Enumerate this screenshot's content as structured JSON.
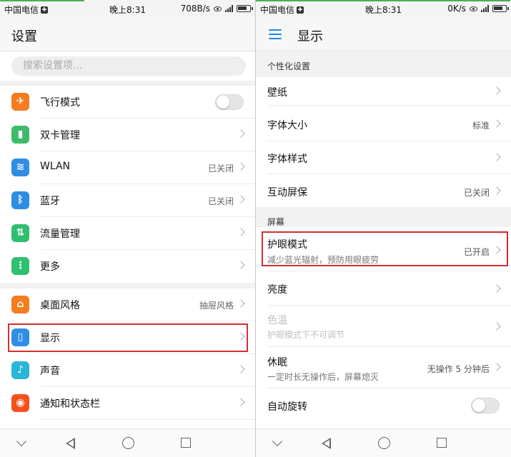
{
  "colors": {
    "accent": "#1e88e5",
    "highlight": "#d32f2f"
  },
  "left": {
    "status": {
      "carrier": "中国电信",
      "time": "晚上8:31",
      "speed": "708B/s",
      "signal": "4G"
    },
    "title": "设置",
    "search_placeholder": "搜索设置项...",
    "items": [
      {
        "label": "飞行模式",
        "icon": "airplane-icon",
        "glyph": "✈",
        "color": "#f57c1f"
      },
      {
        "label": "双卡管理",
        "icon": "sim-card-icon",
        "glyph": "▮",
        "color": "#3dbb6b"
      },
      {
        "label": "WLAN",
        "value": "已关闭",
        "icon": "wifi-icon",
        "glyph": "≋",
        "color": "#2f8de4"
      },
      {
        "label": "蓝牙",
        "value": "已关闭",
        "icon": "bluetooth-icon",
        "glyph": "ᛒ",
        "color": "#2f8de4"
      },
      {
        "label": "流量管理",
        "icon": "data-usage-icon",
        "glyph": "⇅",
        "color": "#2fbf71"
      },
      {
        "label": "更多",
        "icon": "more-icon",
        "glyph": "⋮",
        "color": "#2fbf71"
      },
      {
        "label": "桌面风格",
        "value": "抽屉风格",
        "icon": "home-style-icon",
        "glyph": "⌂",
        "color": "#f57c1f"
      },
      {
        "label": "显示",
        "icon": "display-icon",
        "glyph": "▯",
        "color": "#2f8de4"
      },
      {
        "label": "声音",
        "icon": "sound-icon",
        "glyph": "♪",
        "color": "#29b6d8"
      },
      {
        "label": "通知和状态栏",
        "icon": "notification-icon",
        "glyph": "◉",
        "color": "#f4511e"
      }
    ]
  },
  "right": {
    "status": {
      "carrier": "中国电信",
      "time": "晚上8:31",
      "speed": "0K/s",
      "signal": "4G"
    },
    "title": "显示",
    "sections": {
      "personalize": "个性化设置",
      "screen": "屏幕"
    },
    "items": {
      "wallpaper": {
        "label": "壁纸"
      },
      "font_size": {
        "label": "字体大小",
        "value": "标准"
      },
      "font_style": {
        "label": "字体样式"
      },
      "screensaver": {
        "label": "互动屏保",
        "value": "已关闭"
      },
      "eye_comfort": {
        "label": "护眼模式",
        "sub": "减少蓝光辐射，预防用眼疲劳",
        "value": "已开启"
      },
      "brightness": {
        "label": "亮度"
      },
      "color_temp": {
        "label": "色温",
        "sub": "护眼模式下不可调节"
      },
      "sleep": {
        "label": "休眠",
        "sub": "一定时长无操作后，屏幕熄灭",
        "value": "无操作 5 分钟后"
      },
      "auto_rotate": {
        "label": "自动旋转"
      }
    }
  }
}
